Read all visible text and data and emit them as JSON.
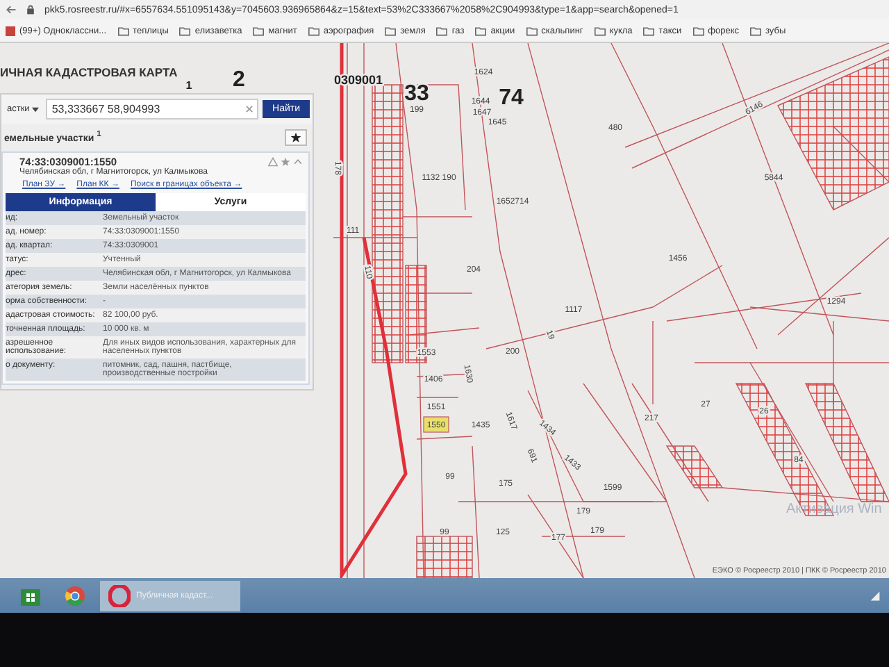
{
  "browser": {
    "url": "pkk5.rosreestr.ru/#x=6557634.551095143&y=7045603.936965864&z=15&text=53%2C333667%2058%2C904993&type=1&app=search&opened=1",
    "bookmarks": [
      {
        "label": "(99+) Одноклассни...",
        "kind": "site"
      },
      {
        "label": "теплицы",
        "kind": "folder"
      },
      {
        "label": "елизаветка",
        "kind": "folder"
      },
      {
        "label": "магнит",
        "kind": "folder"
      },
      {
        "label": "аэрография",
        "kind": "folder"
      },
      {
        "label": "земля",
        "kind": "folder"
      },
      {
        "label": "газ",
        "kind": "folder"
      },
      {
        "label": "акции",
        "kind": "folder"
      },
      {
        "label": "скальпинг",
        "kind": "folder"
      },
      {
        "label": "кукла",
        "kind": "folder"
      },
      {
        "label": "такси",
        "kind": "folder"
      },
      {
        "label": "форекс",
        "kind": "folder"
      },
      {
        "label": "зубы",
        "kind": "folder"
      }
    ]
  },
  "map": {
    "title": "ИЧНАЯ КАДАСТРОВАЯ КАРТА",
    "labels": [
      {
        "text": "1",
        "kind": "small",
        "selected": false
      },
      {
        "text": "2",
        "kind": "quarter",
        "selected": false
      },
      {
        "text": "0309001",
        "kind": "code",
        "selected": false
      },
      {
        "text": "33",
        "kind": "quarter",
        "selected": false
      },
      {
        "text": "74",
        "kind": "quarter",
        "selected": false
      },
      {
        "text": "199",
        "kind": "parcel",
        "selected": false
      },
      {
        "text": "1624",
        "kind": "parcel",
        "selected": false
      },
      {
        "text": "1644",
        "kind": "parcel",
        "selected": false
      },
      {
        "text": "1647",
        "kind": "parcel",
        "selected": false
      },
      {
        "text": "1645",
        "kind": "parcel",
        "selected": false
      },
      {
        "text": "480",
        "kind": "parcel",
        "selected": false
      },
      {
        "text": "6146",
        "kind": "parcel",
        "selected": false
      },
      {
        "text": "5844",
        "kind": "parcel",
        "selected": false
      },
      {
        "text": "178",
        "kind": "parcel",
        "selected": false
      },
      {
        "text": "1132 190",
        "kind": "parcel",
        "selected": false
      },
      {
        "text": "1652714",
        "kind": "parcel",
        "selected": false
      },
      {
        "text": "111",
        "kind": "parcel",
        "selected": false
      },
      {
        "text": "110",
        "kind": "parcel",
        "selected": false
      },
      {
        "text": "204",
        "kind": "parcel",
        "selected": false
      },
      {
        "text": "1456",
        "kind": "parcel",
        "selected": false
      },
      {
        "text": "1294",
        "kind": "parcel",
        "selected": false
      },
      {
        "text": "1117",
        "kind": "parcel",
        "selected": false
      },
      {
        "text": "19",
        "kind": "parcel",
        "selected": false
      },
      {
        "text": "200",
        "kind": "parcel",
        "selected": false
      },
      {
        "text": "1553",
        "kind": "parcel",
        "selected": false
      },
      {
        "text": "1406",
        "kind": "parcel",
        "selected": false
      },
      {
        "text": "1630",
        "kind": "parcel",
        "selected": false
      },
      {
        "text": "1551",
        "kind": "parcel",
        "selected": false
      },
      {
        "text": "1550",
        "kind": "parcel",
        "selected": true
      },
      {
        "text": "1435",
        "kind": "parcel",
        "selected": false
      },
      {
        "text": "1617",
        "kind": "parcel",
        "selected": false
      },
      {
        "text": "1434",
        "kind": "parcel",
        "selected": false
      },
      {
        "text": "691",
        "kind": "parcel",
        "selected": false
      },
      {
        "text": "1433",
        "kind": "parcel",
        "selected": false
      },
      {
        "text": "217",
        "kind": "parcel",
        "selected": false
      },
      {
        "text": "27",
        "kind": "parcel",
        "selected": false
      },
      {
        "text": "26",
        "kind": "parcel",
        "selected": false
      },
      {
        "text": "99",
        "kind": "parcel",
        "selected": false
      },
      {
        "text": "175",
        "kind": "parcel",
        "selected": false
      },
      {
        "text": "1599",
        "kind": "parcel",
        "selected": false
      },
      {
        "text": "179",
        "kind": "parcel",
        "selected": false
      },
      {
        "text": "99",
        "kind": "parcel",
        "selected": false
      },
      {
        "text": "125",
        "kind": "parcel",
        "selected": false
      },
      {
        "text": "177",
        "kind": "parcel",
        "selected": false
      },
      {
        "text": "179",
        "kind": "parcel",
        "selected": false
      },
      {
        "text": "84",
        "kind": "parcel",
        "selected": false
      }
    ],
    "copyright": "ЕЭКО © Росреестр 2010 | ПКК © Росреестр 2010",
    "os_notice": "Активация Win"
  },
  "panel": {
    "search": {
      "type_label": "астки",
      "value": "53,333667 58,904993",
      "button": "Найти"
    },
    "results_title": "емельные участки",
    "results_count": "1",
    "result": {
      "number": "74:33:0309001:1550",
      "address": "Челябинская обл, г Магнитогорск, ул Калмыкова",
      "links": [
        "План ЗУ →",
        "План КК →",
        "Поиск в границах объекта →"
      ]
    },
    "tabs": [
      {
        "label": "Информация",
        "selected": true
      },
      {
        "label": "Услуги",
        "selected": false
      }
    ],
    "rows": [
      {
        "label": "ид:",
        "value": "Земельный участок"
      },
      {
        "label": "ад. номер:",
        "value": "74:33:0309001:1550"
      },
      {
        "label": "ад. квартал:",
        "value": "74:33:0309001"
      },
      {
        "label": "татус:",
        "value": "Учтенный"
      },
      {
        "label": "дрес:",
        "value": "Челябинская обл, г Магнитогорск, ул Калмыкова"
      },
      {
        "label": "атегория земель:",
        "value": "Земли населённых пунктов"
      },
      {
        "label": "орма собственности:",
        "value": "-"
      },
      {
        "label": "адастровая стоимость:",
        "value": "82 100,00 руб."
      },
      {
        "label": "точненная площадь:",
        "value": "10 000 кв. м"
      },
      {
        "label": "азрешенное использование:",
        "value": "Для иных видов использования, характерных для населенных пунктов"
      },
      {
        "label": "о документу:",
        "value": "питомник, сад, пашня, пастбище, производственные постройки"
      }
    ]
  },
  "taskbar": {
    "apps": [
      {
        "kind": "store",
        "selected": false
      },
      {
        "kind": "chrome",
        "selected": false
      },
      {
        "kind": "opera",
        "label": "Публичная кадаст...",
        "selected": true
      }
    ]
  }
}
